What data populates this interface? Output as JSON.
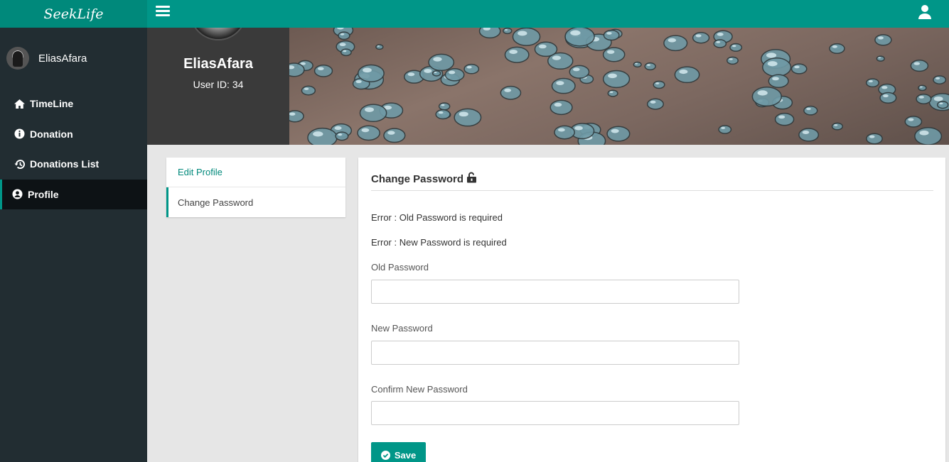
{
  "app": {
    "brand": "SeekLife"
  },
  "colors": {
    "accent": "#009688",
    "sidebar": "#222d32",
    "profile_header": "#3a3a3a"
  },
  "sidebar": {
    "username": "EliasAfara",
    "items": [
      {
        "label": "TimeLine",
        "icon": "home-icon"
      },
      {
        "label": "Donation",
        "icon": "info-circle-icon"
      },
      {
        "label": "Donations List",
        "icon": "history-icon"
      },
      {
        "label": "Profile",
        "icon": "user-circle-icon",
        "active": true
      }
    ]
  },
  "profile": {
    "name": "EliasAfara",
    "user_id_text": "User ID: 34"
  },
  "tabs": [
    {
      "label": "Edit Profile"
    },
    {
      "label": "Change Password",
      "selected": true
    }
  ],
  "form": {
    "title": "Change Password",
    "title_icon": "unlock-icon",
    "errors": [
      "Error : Old Password is required",
      "Error : New Password is required"
    ],
    "fields": {
      "old_password": {
        "label": "Old Password",
        "value": ""
      },
      "new_password": {
        "label": "New Password",
        "value": ""
      },
      "confirm_password": {
        "label": "Confirm New Password",
        "value": ""
      }
    },
    "save_label": "Save",
    "save_icon": "check-circle-icon"
  }
}
